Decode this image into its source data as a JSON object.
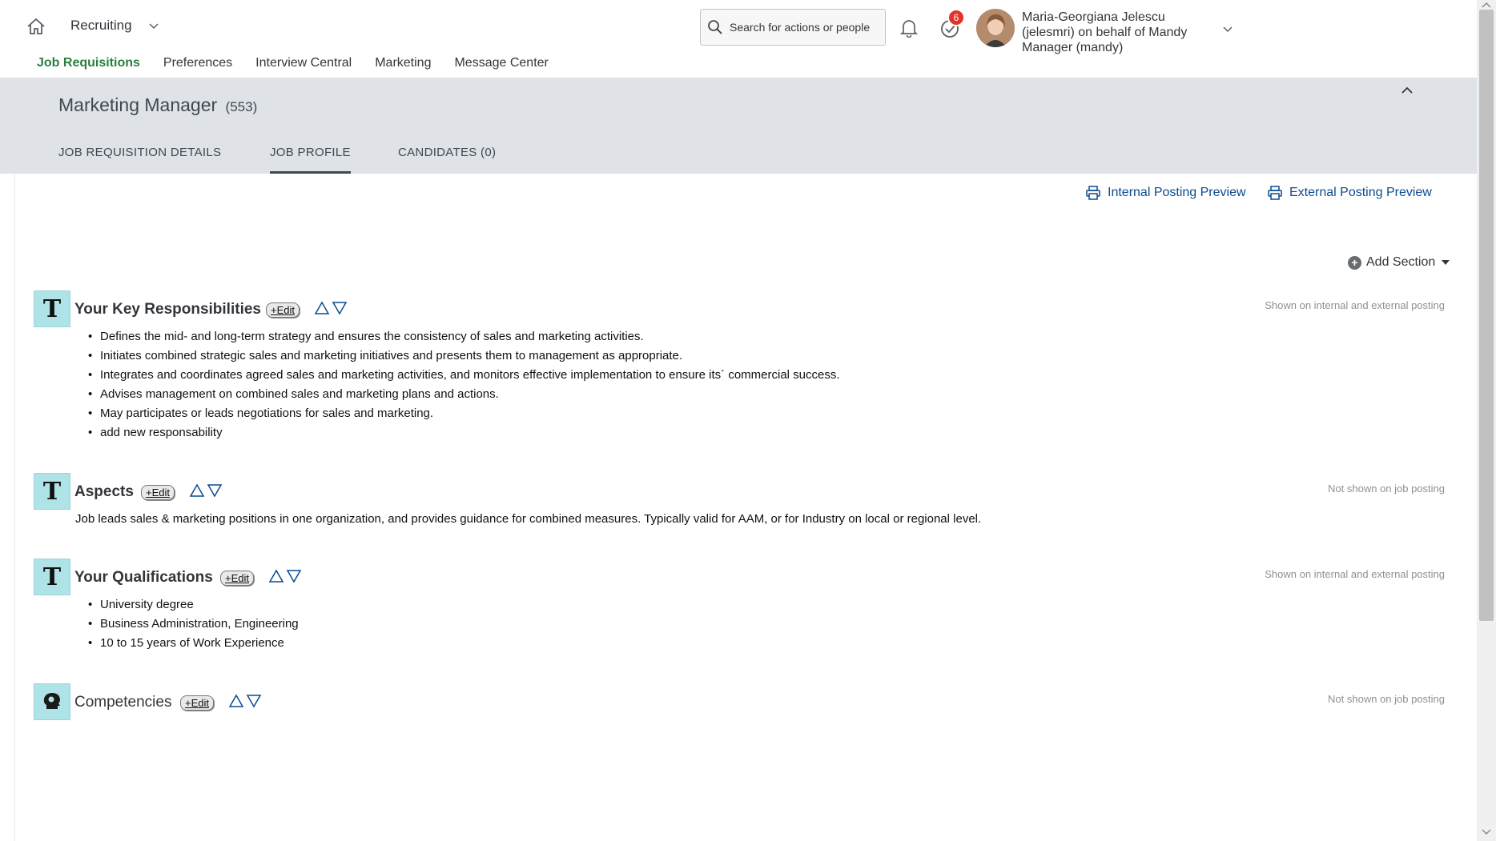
{
  "shell": {
    "module": "Recruiting",
    "search_placeholder": "Search for actions or people",
    "todo_count": "6",
    "user_name": "Maria-Georgiana Jelescu (jelesmri) on behalf of Mandy Manager (mandy)"
  },
  "nav": {
    "items": [
      {
        "label": "Job Requisitions",
        "active": true
      },
      {
        "label": "Preferences"
      },
      {
        "label": "Interview Central"
      },
      {
        "label": "Marketing"
      },
      {
        "label": "Message Center"
      }
    ]
  },
  "header": {
    "title": "Marketing Manager",
    "req_number": "(553)",
    "tabs": [
      {
        "label": "JOB REQUISITION DETAILS"
      },
      {
        "label": "JOB PROFILE",
        "active": true
      },
      {
        "label": "CANDIDATES (0)"
      }
    ]
  },
  "actions": {
    "internal_preview": "Internal Posting Preview",
    "external_preview": "External Posting Preview",
    "add_section": "Add Section"
  },
  "sections": [
    {
      "title": "Your Key Responsibilities",
      "edit": "+Edit",
      "visibility": "Shown on internal and external posting",
      "icon": "text-icon",
      "items": [
        "Defines the mid- and long-term strategy and ensures the consistency of sales and marketing activities.",
        "Initiates combined strategic sales and marketing initiatives and presents them to management as appropriate.",
        "Integrates and coordinates agreed sales and marketing activities, and monitors effective implementation to ensure its´ commercial success.",
        "Advises management on combined sales and marketing plans and actions.",
        "May participates or leads negotiations for sales and marketing.",
        "add new responsability"
      ]
    },
    {
      "title": "Aspects",
      "edit": "+Edit",
      "visibility": "Not shown on job posting",
      "icon": "text-icon",
      "text": "Job leads sales & marketing positions in one organization, and provides guidance for combined measures. Typically valid for AAM, or for Industry on local or regional level."
    },
    {
      "title": "Your Qualifications",
      "edit": "+Edit",
      "visibility": "Shown on internal and external posting",
      "icon": "text-icon",
      "items": [
        "University degree",
        "Business Administration, Engineering",
        "10 to 15 years of Work Experience"
      ]
    },
    {
      "title": "Competencies",
      "edit": "+Edit",
      "visibility": "Not shown on job posting",
      "icon": "head-brain-icon"
    }
  ],
  "colors": {
    "active_nav": "#2a7f3f",
    "link": "#0a4b8f",
    "band": "#dfe3e7",
    "section_icon_bg": "#aee3e8",
    "badge": "#e0342a"
  }
}
